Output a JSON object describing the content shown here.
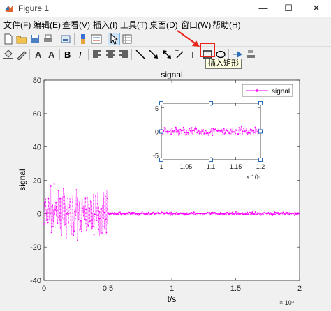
{
  "window": {
    "title": "Figure 1",
    "minimize": "—",
    "maximize": "☐",
    "close": "✕"
  },
  "menu": [
    "文件(F)",
    "编辑(E)",
    "查看(V)",
    "插入(I)",
    "工具(T)",
    "桌面(D)",
    "窗口(W)",
    "帮助(H)"
  ],
  "tooltip": "插入矩形",
  "colors": {
    "signal": "#ff00ff",
    "highlight": "#e8231b",
    "handle": "#2a6ebb"
  },
  "chart_data": [
    {
      "type": "line",
      "title": "signal",
      "xlabel": "t/s",
      "ylabel": "signal",
      "x_exponent": "× 10⁴",
      "xlim": [
        0,
        20000
      ],
      "ylim": [
        -40,
        80
      ],
      "xticks": [
        "0",
        "0.5",
        "1",
        "1.5",
        "2"
      ],
      "yticks": [
        "-40",
        "-20",
        "0",
        "20",
        "40",
        "60",
        "80"
      ],
      "legend": {
        "label": "signal",
        "position": "top-right"
      },
      "series": [
        {
          "name": "signal",
          "segments": [
            {
              "x_range": [
                0,
                5000
              ],
              "amplitude": 28
            },
            {
              "x_range": [
                5000,
                20000
              ],
              "amplitude": 2
            }
          ]
        }
      ]
    },
    {
      "type": "line",
      "title": "",
      "x_exponent": "× 10⁴",
      "xlim": [
        10000,
        12000
      ],
      "ylim": [
        -6,
        6
      ],
      "xticks": [
        "1",
        "1.05",
        "1.1",
        "1.15",
        "1.2"
      ],
      "yticks": [
        "-5",
        "0",
        "5"
      ],
      "series": [
        {
          "segments": [
            {
              "x_range": [
                10000,
                12000
              ],
              "amplitude": 2
            }
          ]
        }
      ]
    }
  ]
}
